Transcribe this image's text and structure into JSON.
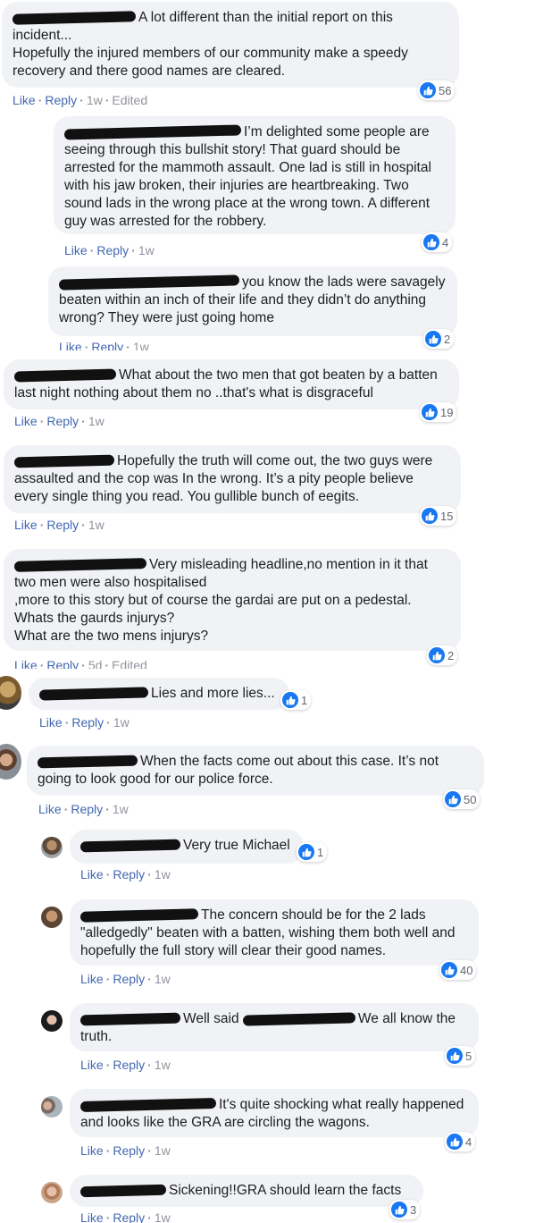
{
  "actions": {
    "like": "Like",
    "reply": "Reply",
    "edited": "Edited",
    "dot": "·"
  },
  "comments": [
    {
      "text": "A lot different than the initial report on this incident...\nHopefully the injured members of our community make a speedy recovery and there good names are cleared.",
      "time": "1w",
      "edited": true,
      "likes": "56"
    },
    {
      "text": "I’m delighted some people are seeing through this bullshit story! That guard should be arrested for the mammoth assault. One lad is still in hospital with his jaw broken, their injuries are heartbreaking. Two sound lads in the wrong place at the wrong town. A different guy was arrested for the robbery.",
      "time": "1w",
      "likes": "4"
    },
    {
      "text": "you know the lads were savagely beaten within an inch of their life and they didn’t do anything wrong? They were just going home",
      "time": "1w",
      "likes": "2"
    },
    {
      "text": "What about the two men that got beaten by a batten last night nothing about them no ..that's what is disgraceful",
      "time": "1w",
      "likes": "19"
    },
    {
      "text": "Hopefully the truth will come out, the two guys were assaulted and the cop was In the wrong. It’s a pity people believe every single thing you read. You gullible bunch of eegits.",
      "time": "1w",
      "likes": "15"
    },
    {
      "text": "Very misleading headline,no mention in it that two men were also hospitalised\n,more to this story but of course the gardai are put on a pedestal.\nWhats the gaurds injurys?\nWhat are the two mens injurys?",
      "time": "5d",
      "edited": true,
      "likes": "2"
    },
    {
      "text": "Lies and more lies...",
      "time": "1w",
      "likes": "1"
    },
    {
      "text": "When the facts come out about this case. It’s not going to look good for our police force.",
      "time": "1w",
      "likes": "50"
    },
    {
      "text": "Very true Michael",
      "time": "1w",
      "likes": "1"
    },
    {
      "text": "The concern should be for the 2 lads \"alledgedly\" beaten with a batten, wishing them both well and hopefully the full story will clear their good names.",
      "time": "1w",
      "likes": "40"
    },
    {
      "text_a": "Well said",
      "text_b": "We all know the truth.",
      "time": "1w",
      "likes": "5"
    },
    {
      "text": "It's quite shocking what really happened and looks like the GRA are circling the wagons.",
      "time": "1w",
      "likes": "4"
    },
    {
      "text": "Sickening!!GRA should learn the facts",
      "time": "1w",
      "likes": "3"
    }
  ]
}
